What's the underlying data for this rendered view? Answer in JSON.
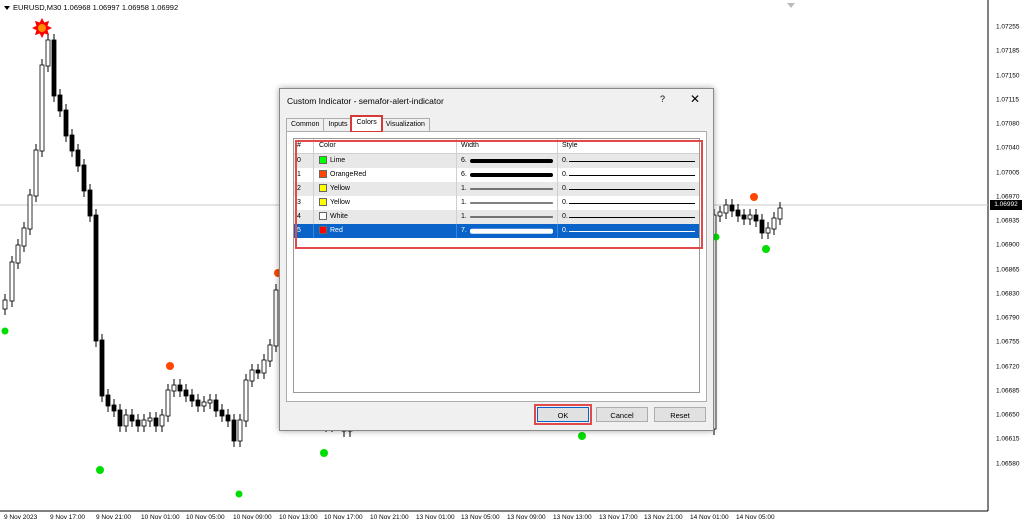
{
  "chart": {
    "symbol_line": "EURUSD,M30  1.06968 1.06997 1.06958 1.06992",
    "current_price": "1.06992",
    "price_axis": [
      "1.07255",
      "1.07185",
      "1.07150",
      "1.07115",
      "1.07080",
      "1.07040",
      "1.07005",
      "1.06970",
      "1.06935",
      "1.06900",
      "1.06865",
      "1.06830",
      "1.06790",
      "1.06755",
      "1.06720",
      "1.06685",
      "1.06650",
      "1.06615",
      "1.06580"
    ],
    "time_axis": [
      "9 Nov 2023",
      "9 Nov 17:00",
      "9 Nov 21:00",
      "10 Nov 01:00",
      "10 Nov 05:00",
      "10 Nov 09:00",
      "10 Nov 13:00",
      "10 Nov 17:00",
      "10 Nov 21:00",
      "13 Nov 01:00",
      "13 Nov 05:00",
      "13 Nov 09:00",
      "13 Nov 13:00",
      "13 Nov 17:00",
      "13 Nov 21:00",
      "14 Nov 01:00",
      "14 Nov 05:00"
    ],
    "colors": {
      "bull": "#ffffff",
      "bear": "#000000",
      "signal_high": "#ff4500",
      "signal_low": "#00dd00",
      "signal_big": "#ff0000"
    }
  },
  "dialog": {
    "title": "Custom Indicator - semafor-alert-indicator",
    "help": "?",
    "close": "✕",
    "tabs": [
      "Common",
      "Inputs",
      "Colors",
      "Visualization"
    ],
    "active_tab": "Colors",
    "columns": [
      "#",
      "Color",
      "Width",
      "Style"
    ],
    "rows": [
      {
        "index": "0",
        "color_name": "Lime",
        "color": "#00ff00",
        "width": "6.",
        "width_value": 6,
        "style": "0."
      },
      {
        "index": "1",
        "color_name": "OrangeRed",
        "color": "#ff4500",
        "width": "6.",
        "width_value": 6,
        "style": "0."
      },
      {
        "index": "2",
        "color_name": "Yellow",
        "color": "#ffff00",
        "width": "1.",
        "width_value": 1,
        "style": "0."
      },
      {
        "index": "3",
        "color_name": "Yellow",
        "color": "#ffff00",
        "width": "1.",
        "width_value": 1,
        "style": "0."
      },
      {
        "index": "4",
        "color_name": "White",
        "color": "#ffffff",
        "width": "1.",
        "width_value": 1,
        "style": "0."
      },
      {
        "index": "5",
        "color_name": "Red",
        "color": "#ff0000",
        "width": "7.",
        "width_value": 7,
        "style": "0."
      }
    ],
    "selected_row": 5,
    "buttons": {
      "ok": "OK",
      "cancel": "Cancel",
      "reset": "Reset"
    },
    "accent": "#0a63c9",
    "highlight": "#e04a4a"
  }
}
